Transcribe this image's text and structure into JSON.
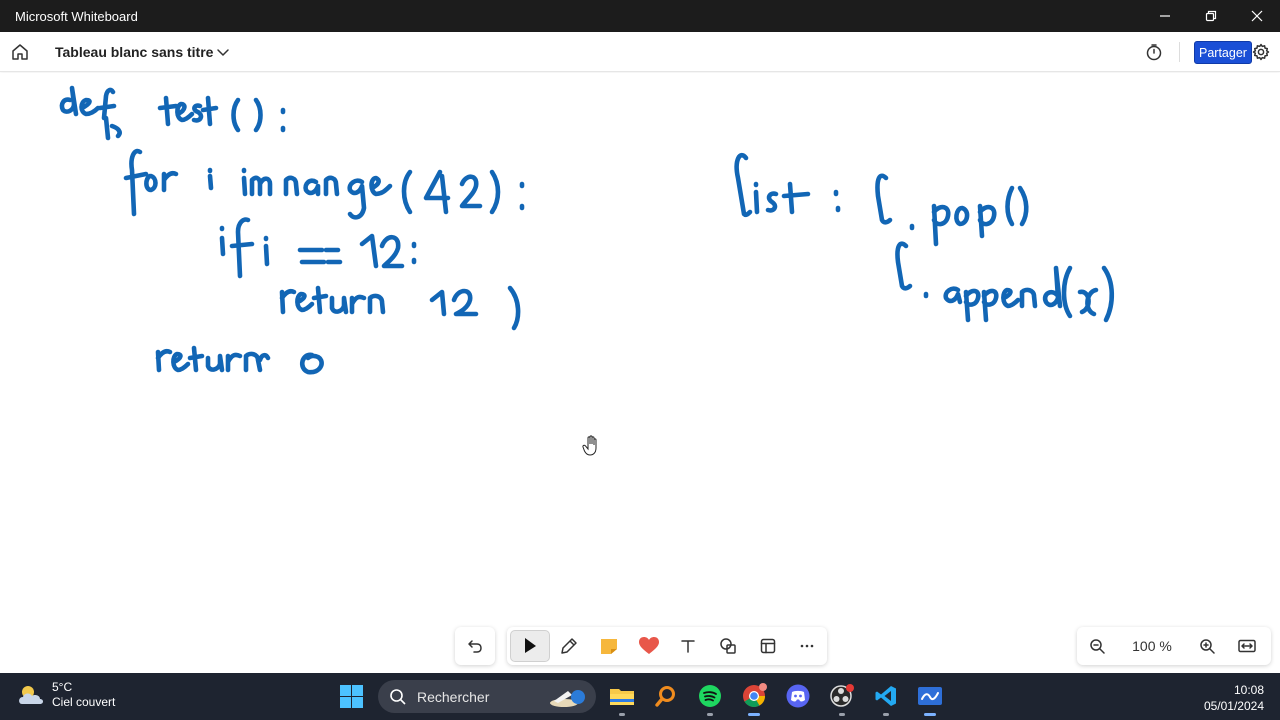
{
  "window": {
    "title": "Microsoft Whiteboard"
  },
  "header": {
    "board_title": "Tableau blanc sans titre",
    "share_label": "Partager"
  },
  "toolbar": {
    "undo": "undo-icon",
    "tools": [
      "select-icon",
      "pen-icon",
      "sticky-note-icon",
      "reaction-icon",
      "text-icon",
      "shapes-icon",
      "template-icon",
      "more-icon"
    ],
    "active_tool": "select-icon"
  },
  "zoom": {
    "level": "100 %"
  },
  "taskbar": {
    "weather_temp": "5°C",
    "weather_desc": "Ciel couvert",
    "search_placeholder": "Rechercher",
    "apps": [
      "file-explorer-icon",
      "search-app-icon",
      "spotify-icon",
      "chrome-icon",
      "discord-icon",
      "obs-icon",
      "vscode-icon",
      "whiteboard-icon"
    ],
    "time": "10:08",
    "date": "05/01/2024"
  },
  "colors": {
    "ink": "#1266b5",
    "accent": "#1a4fd6",
    "taskbar": "#1e2430"
  }
}
